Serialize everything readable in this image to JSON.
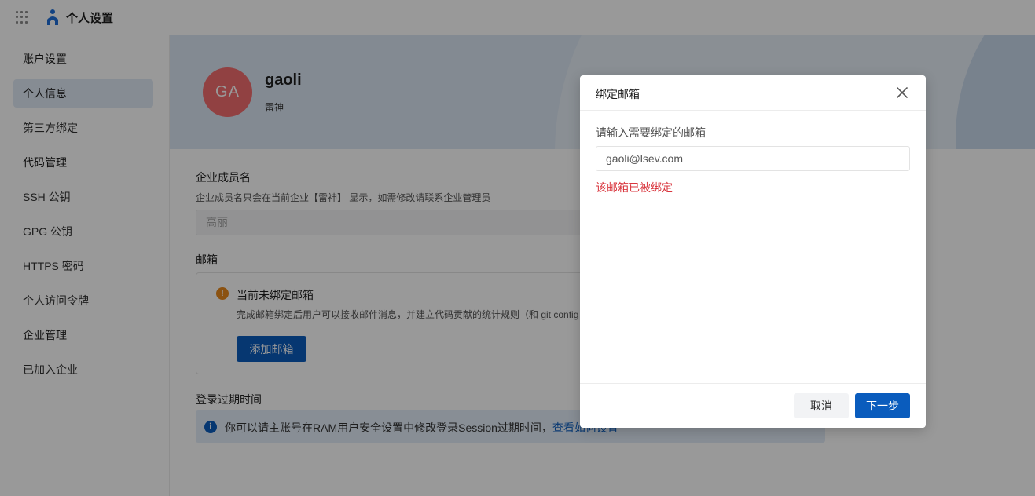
{
  "header": {
    "app_title": "个人设置"
  },
  "sidebar": {
    "items": [
      {
        "label": "账户设置",
        "type": "group",
        "active": false
      },
      {
        "label": "个人信息",
        "type": "item",
        "active": true
      },
      {
        "label": "第三方绑定",
        "type": "item",
        "active": false
      },
      {
        "label": "代码管理",
        "type": "group",
        "active": false
      },
      {
        "label": "SSH 公钥",
        "type": "item",
        "active": false
      },
      {
        "label": "GPG 公钥",
        "type": "item",
        "active": false
      },
      {
        "label": "HTTPS 密码",
        "type": "item",
        "active": false
      },
      {
        "label": "个人访问令牌",
        "type": "item",
        "active": false
      },
      {
        "label": "企业管理",
        "type": "group",
        "active": false
      },
      {
        "label": "已加入企业",
        "type": "item",
        "active": false
      }
    ]
  },
  "profile": {
    "avatar_initials": "GA",
    "avatar_color": "#f26d6f",
    "name": "gaoli",
    "org": "雷神"
  },
  "member_name": {
    "title": "企业成员名",
    "hint": "企业成员名只会在当前企业【雷神】 显示，如需修改请联系企业管理员",
    "value": "高丽"
  },
  "email_section": {
    "title": "邮箱",
    "warning_title": "当前未绑定邮箱",
    "warning_desc": "完成邮箱绑定后用户可以接收邮件消息，并建立代码贡献的统计规则（和 git config",
    "add_button": "添加邮箱"
  },
  "login_expiry": {
    "title": "登录过期时间",
    "info_text": "你可以请主账号在RAM用户安全设置中修改登录Session过期时间，",
    "info_link": "查看如何设置"
  },
  "dialog": {
    "title": "绑定邮箱",
    "field_label": "请输入需要绑定的邮箱",
    "email_value": "gaoli@lsev.com",
    "error": "该邮箱已被绑定",
    "cancel_label": "取消",
    "next_label": "下一步"
  },
  "colors": {
    "primary": "#0a5cbd",
    "error": "#d9363e",
    "warning": "#e8891d"
  }
}
